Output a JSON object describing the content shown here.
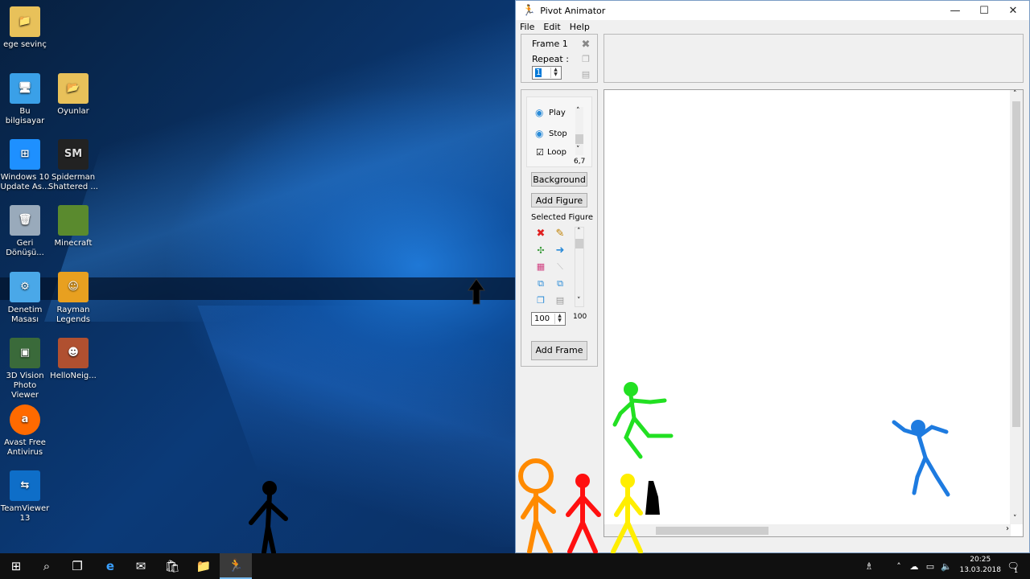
{
  "desktop": {
    "icons": [
      {
        "label": "ege sevinç",
        "icon": "folder-user-icon",
        "color": "#e8c15a"
      },
      {
        "label": "Bu bilgisayar",
        "icon": "computer-icon",
        "color": "#3aa0e8"
      },
      {
        "label": "Oyunlar",
        "icon": "folder-games-icon",
        "color": "#e8c15a"
      },
      {
        "label": "Windows 10 Update As...",
        "icon": "windows-logo-icon",
        "color": "#1e90ff"
      },
      {
        "label": "Spiderman Shattered ...",
        "icon": "sm-logo-icon",
        "color": "#222"
      },
      {
        "label": "Geri Dönüşü...",
        "icon": "recycle-bin-icon",
        "color": "#9ab"
      },
      {
        "label": "Minecraft",
        "icon": "grass-block-icon",
        "color": "#5a8a2e"
      },
      {
        "label": "Denetim Masası",
        "icon": "control-panel-icon",
        "color": "#4aa8e8"
      },
      {
        "label": "Rayman Legends",
        "icon": "rayman-icon",
        "color": "#e8a020"
      },
      {
        "label": "3D Vision Photo Viewer",
        "icon": "photo-viewer-icon",
        "color": "#3a6a3a"
      },
      {
        "label": "HelloNeig...",
        "icon": "hello-neighbor-icon",
        "color": "#b05030"
      },
      {
        "label": "Avast Free Antivirus",
        "icon": "avast-icon",
        "color": "#ff6a00"
      },
      {
        "label": "TeamViewer 13",
        "icon": "teamviewer-icon",
        "color": "#0e6ec8"
      }
    ]
  },
  "window": {
    "title": "Pivot Animator",
    "menu": [
      "File",
      "Edit",
      "Help"
    ],
    "frame_label": "Frame 1",
    "repeat_label": "Repeat :",
    "repeat_value": "1",
    "play_label": "Play",
    "stop_label": "Stop",
    "loop_label": "Loop",
    "speed_value": "6,7",
    "background_label": "Background",
    "add_figure_label": "Add Figure",
    "selected_figure_label": "Selected Figure",
    "scale_value": "100",
    "scale_max": "100",
    "add_frame_label": "Add Frame"
  },
  "taskbar": {
    "time": "20:25",
    "date": "13.03.2018",
    "notification_count": "1"
  },
  "colors": {
    "figure_green": "#22e022",
    "figure_blue": "#1e7be0",
    "figure_orange": "#ff8a00",
    "figure_red": "#ff1010",
    "figure_yellow": "#ffee00",
    "figure_black": "#000000"
  }
}
